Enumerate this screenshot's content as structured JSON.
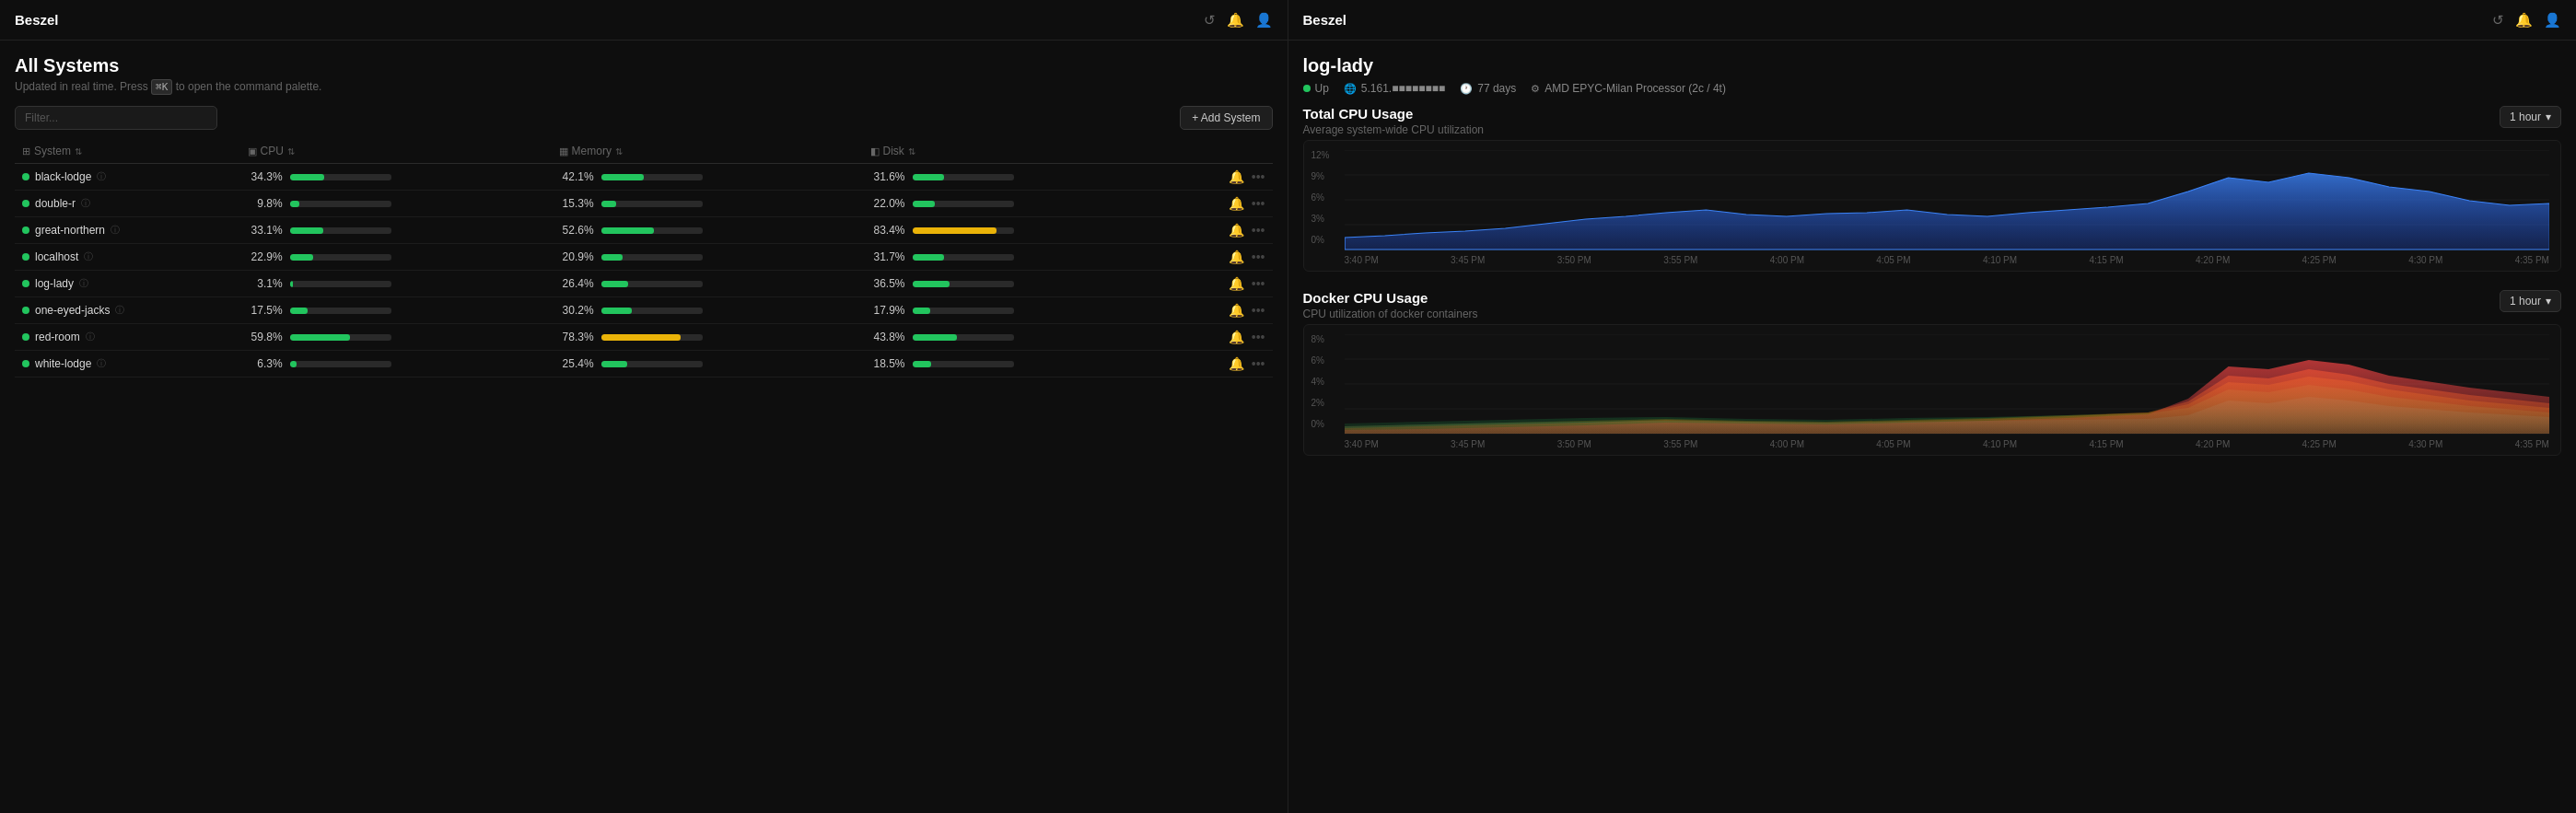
{
  "app": {
    "title": "Beszel",
    "icons": [
      "refresh-icon",
      "notification-icon",
      "user-icon"
    ]
  },
  "left": {
    "page_title": "All Systems",
    "page_subtitle_pre": "Updated in real time. Press",
    "page_shortcut": "⌘K",
    "page_subtitle_post": "to open the command palette.",
    "filter_placeholder": "Filter...",
    "add_button_label": "+ Add System",
    "columns": [
      {
        "label": "System",
        "icon": "sort-icon"
      },
      {
        "label": "CPU",
        "icon": "sort-icon"
      },
      {
        "label": "Memory",
        "icon": "sort-icon"
      },
      {
        "label": "Disk",
        "icon": "sort-icon"
      }
    ],
    "systems": [
      {
        "name": "black-lodge",
        "status": "green",
        "cpu": "34.3%",
        "cpu_pct": 34.3,
        "mem": "42.1%",
        "mem_pct": 42.1,
        "mem_color": "green",
        "disk": "31.6%",
        "disk_pct": 31.6,
        "disk_color": "green"
      },
      {
        "name": "double-r",
        "status": "green",
        "cpu": "9.8%",
        "cpu_pct": 9.8,
        "mem": "15.3%",
        "mem_pct": 15.3,
        "mem_color": "green",
        "disk": "22.0%",
        "disk_pct": 22.0,
        "disk_color": "green"
      },
      {
        "name": "great-northern",
        "status": "green",
        "cpu": "33.1%",
        "cpu_pct": 33.1,
        "mem": "52.6%",
        "mem_pct": 52.6,
        "mem_color": "green",
        "disk": "83.4%",
        "disk_pct": 83.4,
        "disk_color": "yellow"
      },
      {
        "name": "localhost",
        "status": "green",
        "cpu": "22.9%",
        "cpu_pct": 22.9,
        "mem": "20.9%",
        "mem_pct": 20.9,
        "mem_color": "green",
        "disk": "31.7%",
        "disk_pct": 31.7,
        "disk_color": "green"
      },
      {
        "name": "log-lady",
        "status": "green",
        "cpu": "3.1%",
        "cpu_pct": 3.1,
        "mem": "26.4%",
        "mem_pct": 26.4,
        "mem_color": "green",
        "disk": "36.5%",
        "disk_pct": 36.5,
        "disk_color": "green"
      },
      {
        "name": "one-eyed-jacks",
        "status": "green",
        "cpu": "17.5%",
        "cpu_pct": 17.5,
        "mem": "30.2%",
        "mem_pct": 30.2,
        "mem_color": "green",
        "disk": "17.9%",
        "disk_pct": 17.9,
        "disk_color": "green"
      },
      {
        "name": "red-room",
        "status": "green",
        "cpu": "59.8%",
        "cpu_pct": 59.8,
        "mem": "78.3%",
        "mem_pct": 78.3,
        "mem_color": "yellow",
        "disk": "43.8%",
        "disk_pct": 43.8,
        "disk_color": "green"
      },
      {
        "name": "white-lodge",
        "status": "green",
        "cpu": "6.3%",
        "cpu_pct": 6.3,
        "mem": "25.4%",
        "mem_pct": 25.4,
        "mem_color": "green",
        "disk": "18.5%",
        "disk_pct": 18.5,
        "disk_color": "green"
      }
    ]
  },
  "right": {
    "system_name": "log-lady",
    "status": "Up",
    "ip": "5.161.■■■■■■■■",
    "uptime": "77 days",
    "cpu_info": "AMD EPYC-Milan Processor (2c / 4t)",
    "charts": [
      {
        "id": "total-cpu",
        "title": "Total CPU Usage",
        "subtitle": "Average system-wide CPU utilization",
        "timerange": "1 hour",
        "y_labels": [
          "12%",
          "9%",
          "6%",
          "3%",
          "0%"
        ],
        "x_labels": [
          "3:40 PM",
          "3:45 PM",
          "3:50 PM",
          "3:55 PM",
          "4:00 PM",
          "4:05 PM",
          "4:10 PM",
          "4:15 PM",
          "4:20 PM",
          "4:25 PM",
          "4:30 PM",
          "4:35 PM"
        ]
      },
      {
        "id": "docker-cpu",
        "title": "Docker CPU Usage",
        "subtitle": "CPU utilization of docker containers",
        "timerange": "1 hour",
        "y_labels": [
          "8%",
          "6%",
          "4%",
          "2%",
          "0%"
        ],
        "x_labels": [
          "3:40 PM",
          "3:45 PM",
          "3:50 PM",
          "3:55 PM",
          "4:00 PM",
          "4:05 PM",
          "4:10 PM",
          "4:15 PM",
          "4:20 PM",
          "4:25 PM",
          "4:30 PM",
          "4:35 PM"
        ]
      }
    ]
  }
}
